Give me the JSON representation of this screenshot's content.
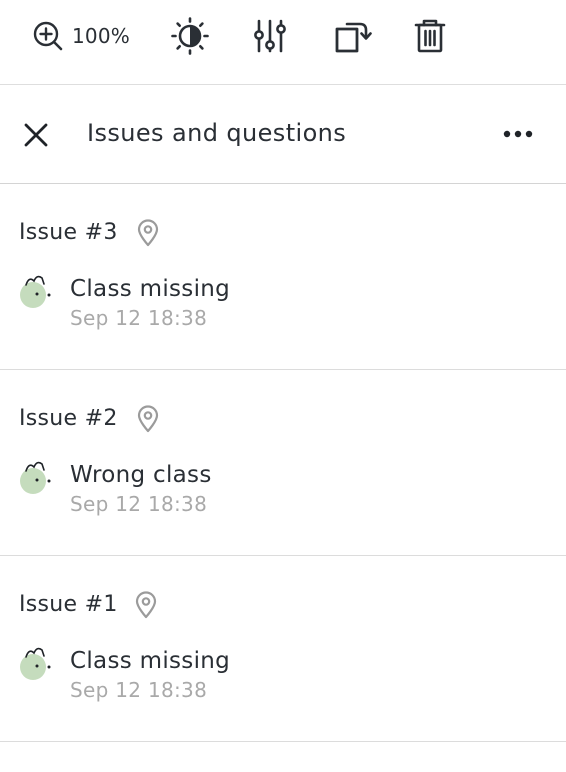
{
  "toolbar": {
    "zoom_label": "100%",
    "tools": [
      "zoom-in-icon",
      "brightness-contrast-icon",
      "adjust-sliders-icon",
      "rotate-icon",
      "delete-icon"
    ]
  },
  "panel": {
    "title": "Issues and questions",
    "close_icon": "close-icon",
    "more_icon": "more-options-icon"
  },
  "colors": {
    "avatar_fill": "#c5dcbd",
    "text": "#2a2f35",
    "muted": "#a9a9a9",
    "divider": "#dcdcdc"
  },
  "issues": [
    {
      "title": "Issue #3",
      "comment": "Class missing",
      "time": "Sep 12 18:38"
    },
    {
      "title": "Issue #2",
      "comment": "Wrong class",
      "time": "Sep 12 18:38"
    },
    {
      "title": "Issue #1",
      "comment": "Class missing",
      "time": "Sep 12 18:38"
    }
  ]
}
